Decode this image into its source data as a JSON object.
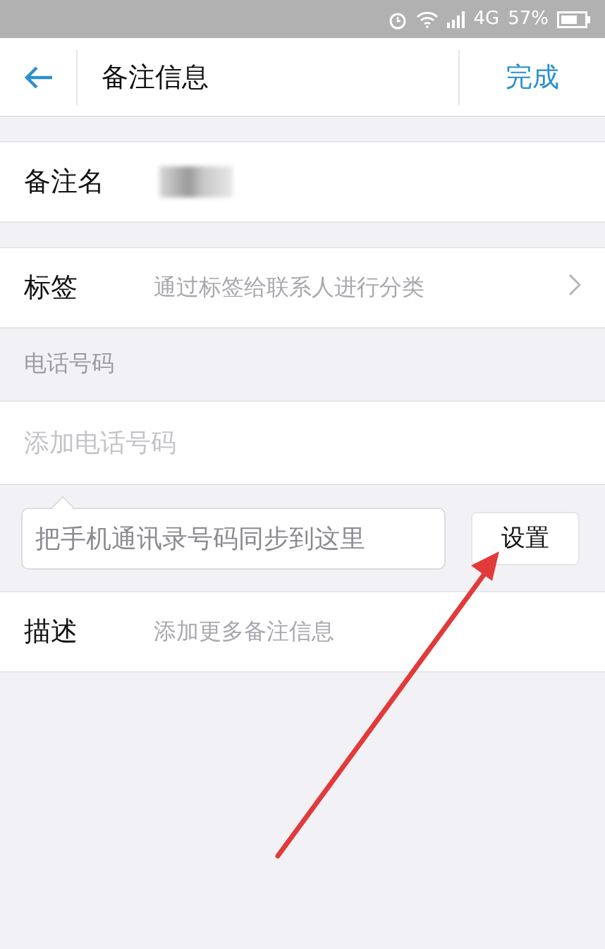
{
  "status_bar": {
    "network": "4G",
    "battery": "57%"
  },
  "header": {
    "title": "备注信息",
    "action": "完成"
  },
  "name_row": {
    "label": "备注名",
    "value_blurred": true
  },
  "tag_row": {
    "label": "标签",
    "hint": "通过标签给联系人进行分类"
  },
  "phone_section": {
    "title": "电话号码",
    "placeholder": "添加电话号码"
  },
  "sync_tip": {
    "text": "把手机通讯录号码同步到这里",
    "button": "设置"
  },
  "description_row": {
    "label": "描述",
    "placeholder": "添加更多备注信息"
  },
  "annotation": {
    "kind": "arrow"
  }
}
